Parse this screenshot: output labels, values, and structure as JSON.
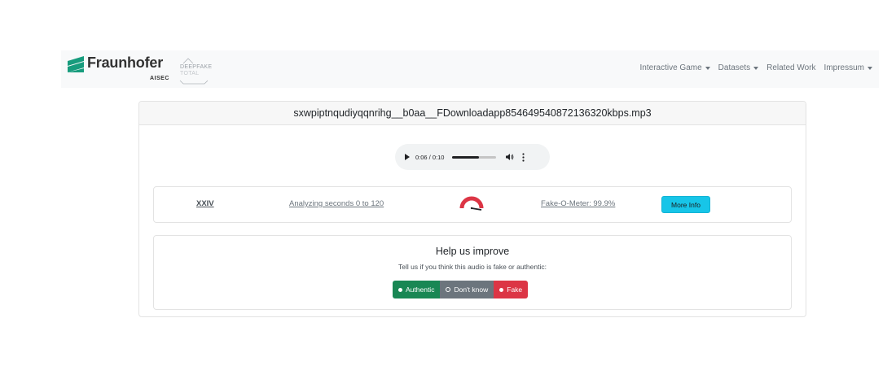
{
  "navbar": {
    "brand_name": "Fraunhofer",
    "brand_sub": "AISEC",
    "deepfake_line1": "DEEPFAKE",
    "deepfake_line2": "TOTAL",
    "links": [
      {
        "label": "Interactive Game",
        "has_dropdown": true
      },
      {
        "label": "Datasets",
        "has_dropdown": true
      },
      {
        "label": "Related Work",
        "has_dropdown": false
      },
      {
        "label": "Impressum",
        "has_dropdown": true
      }
    ]
  },
  "card": {
    "filename": "sxwpiptnqudiyqqnrihg__b0aa__FDownloadapp854649540872136320kbps.mp3"
  },
  "player": {
    "time": "0:06 / 0:10",
    "progress_fraction": 0.6,
    "icons": {
      "play": "play-icon",
      "volume": "volume-icon",
      "more": "more-vertical-icon"
    }
  },
  "result": {
    "id": "XXIV",
    "range_text": "Analyzing seconds 0 to 120",
    "meter_text": "Fake-O-Meter: 99.9%",
    "meter_value": 0.999,
    "gauge_color": "#dc3545",
    "more_info_label": "More Info"
  },
  "feedback": {
    "title": "Help us improve",
    "subtitle": "Tell us if you think this audio is fake or authentic:",
    "buttons": {
      "authentic": "Authentic",
      "dont_know": "Don't know",
      "fake": "Fake"
    }
  },
  "colors": {
    "authentic": "#198754",
    "dont_know": "#6c757d",
    "fake": "#dc3545",
    "info": "#17c5e8",
    "brand_green": "#179c7d"
  }
}
